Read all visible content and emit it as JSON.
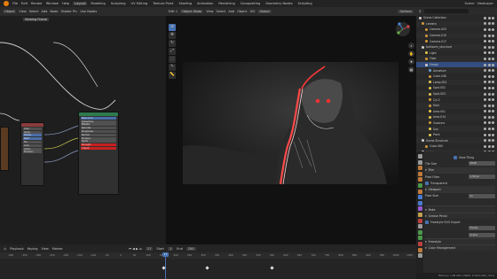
{
  "menubar": {
    "menus": [
      "File",
      "Edit",
      "Render",
      "Window",
      "Help"
    ],
    "workspaces": [
      "Layout",
      "Modeling",
      "Sculpting",
      "UV Editing",
      "Texture Paint",
      "Shading",
      "Animation",
      "Rendering",
      "Compositing",
      "Geometry Nodes",
      "Scripting"
    ],
    "active_workspace": "Layout",
    "scene": "Scene",
    "view_layer": "ViewLayer"
  },
  "node_editor": {
    "header": [
      "Object",
      "View",
      "Select",
      "Add",
      "Node",
      "Shader Pri.",
      "Use Nodes"
    ],
    "frame_label": "Viewing Frame",
    "nodes": {
      "left_node_rows": [
        "Color",
        "Alpha",
        "Shader",
        "BSDF",
        "Fac",
        "Color",
        "Vector",
        "Emission"
      ],
      "main_node_rows": [
        "Base Color",
        "Subsurface",
        "Metallic",
        "Specular",
        "Roughness",
        "Normal",
        "Emission",
        "Alpha",
        "Strength",
        "Output"
      ]
    }
  },
  "viewport": {
    "header": [
      "Edit 1",
      "Object Mode",
      "View",
      "Select",
      "Add",
      "Object",
      "GIS",
      "Global"
    ],
    "tools": [
      "cursor-icon",
      "move-icon",
      "rotate-icon",
      "scale-icon",
      "transform-icon",
      "annotate-icon",
      "measure-icon"
    ],
    "nav": [
      "zoom-icon",
      "pan-icon",
      "camera-view-icon",
      "ortho-icon"
    ],
    "options": "Options"
  },
  "outliner": {
    "rows": [
      {
        "label": "Scene Collection",
        "color": "#d0d0d0"
      },
      {
        "label": "camera",
        "color": "#d59a3a"
      },
      {
        "label": "Camera.003",
        "color": "#d59a3a"
      },
      {
        "label": "Camera.010",
        "color": "#d59a3a"
      },
      {
        "label": "Camera.017",
        "color": "#d59a3a"
      },
      {
        "label": "ballroom_structure",
        "color": "#d0d0d0"
      },
      {
        "label": "Light",
        "color": "#e3c850"
      },
      {
        "label": "Floor",
        "color": "#d59a3a"
      },
      {
        "label": "Empty",
        "color": "#d0d0d0"
      },
      {
        "label": "Armature",
        "color": "#6aa0d6"
      },
      {
        "label": "Cube.046",
        "color": "#d59a3a"
      },
      {
        "label": "Lamp.001",
        "color": "#e3c850"
      },
      {
        "label": "Spot.002",
        "color": "#e3c850"
      },
      {
        "label": "Spot.003",
        "color": "#e3c850"
      },
      {
        "label": "Cyl.2",
        "color": "#d59a3a"
      },
      {
        "label": "floor",
        "color": "#d59a3a"
      },
      {
        "label": "Area.001",
        "color": "#e3c850"
      },
      {
        "label": "Area.014",
        "color": "#e3c850"
      },
      {
        "label": "Suzanne",
        "color": "#d59a3a"
      },
      {
        "label": "Sun",
        "color": "#e3c850"
      },
      {
        "label": "Point",
        "color": "#e3c850"
      },
      {
        "label": "Scene Structure",
        "color": "#d0d0d0"
      },
      {
        "label": "Cube.060",
        "color": "#d59a3a"
      },
      {
        "label": "Lighting",
        "color": "#d0d0d0"
      }
    ],
    "selected_index": 8
  },
  "properties": {
    "rows": [
      {
        "label": "",
        "value": "View Tiling",
        "kind": "check"
      },
      {
        "label": "Tile Size",
        "value": "2048",
        "kind": "field"
      },
      {
        "label": "Film",
        "value": "",
        "kind": "section"
      },
      {
        "label": "Pixel Filter",
        "value": "1.50 px",
        "kind": "field"
      },
      {
        "label": "Transparent",
        "value": "",
        "kind": "check2"
      },
      {
        "label": "Viewport",
        "value": "",
        "kind": "section"
      },
      {
        "label": "Pixel Size",
        "value": "1x",
        "kind": "field"
      },
      {
        "label": "",
        "value": "",
        "kind": "blank"
      },
      {
        "label": "Bake",
        "value": "",
        "kind": "section2"
      },
      {
        "label": "Grease Pencil",
        "value": "",
        "kind": "section2"
      },
      {
        "label": "Freestyle SVG Export",
        "value": "",
        "kind": "check2"
      },
      {
        "label": "",
        "value": "Frame",
        "kind": "field"
      },
      {
        "label": "",
        "value": "Scene",
        "kind": "field"
      },
      {
        "label": "Freestyle",
        "value": "",
        "kind": "section2"
      },
      {
        "label": "Color Management",
        "value": "",
        "kind": "section2"
      }
    ],
    "tab_colors": [
      "#9a9a9a",
      "#9a9a9a",
      "#c07a3a",
      "#c07a3a",
      "#c07a3a",
      "#4a9a4a",
      "#c07a3a",
      "#4a7ad0",
      "#4a7ad0",
      "#9a5ad0",
      "#c0a050",
      "#c04040",
      "#9a9a9a",
      "#4a9a4a",
      "#4a9a4a",
      "#c04040",
      "#c07a3a",
      "#9a9a9a"
    ]
  },
  "timeline": {
    "menus": [
      "Playback",
      "Keying",
      "View",
      "Marker"
    ],
    "current_frame": "17",
    "start_label": "Start",
    "start": "1",
    "end_label": "End",
    "end": "250",
    "ticks": [
      "-400",
      "-350",
      "-300",
      "-250",
      "-200",
      "-150",
      "-100",
      "-50",
      "0",
      "50",
      "100",
      "150",
      "200",
      "250",
      "300",
      "350",
      "400",
      "450",
      "500",
      "550",
      "600",
      "650",
      "700",
      "750",
      "800",
      "850",
      "900",
      "950",
      "1000",
      "1050"
    ]
  },
  "status": {
    "text": "Memory: 1.98 GiB | VRAM: 3.5/8.0 GiB | 3.6.0"
  }
}
